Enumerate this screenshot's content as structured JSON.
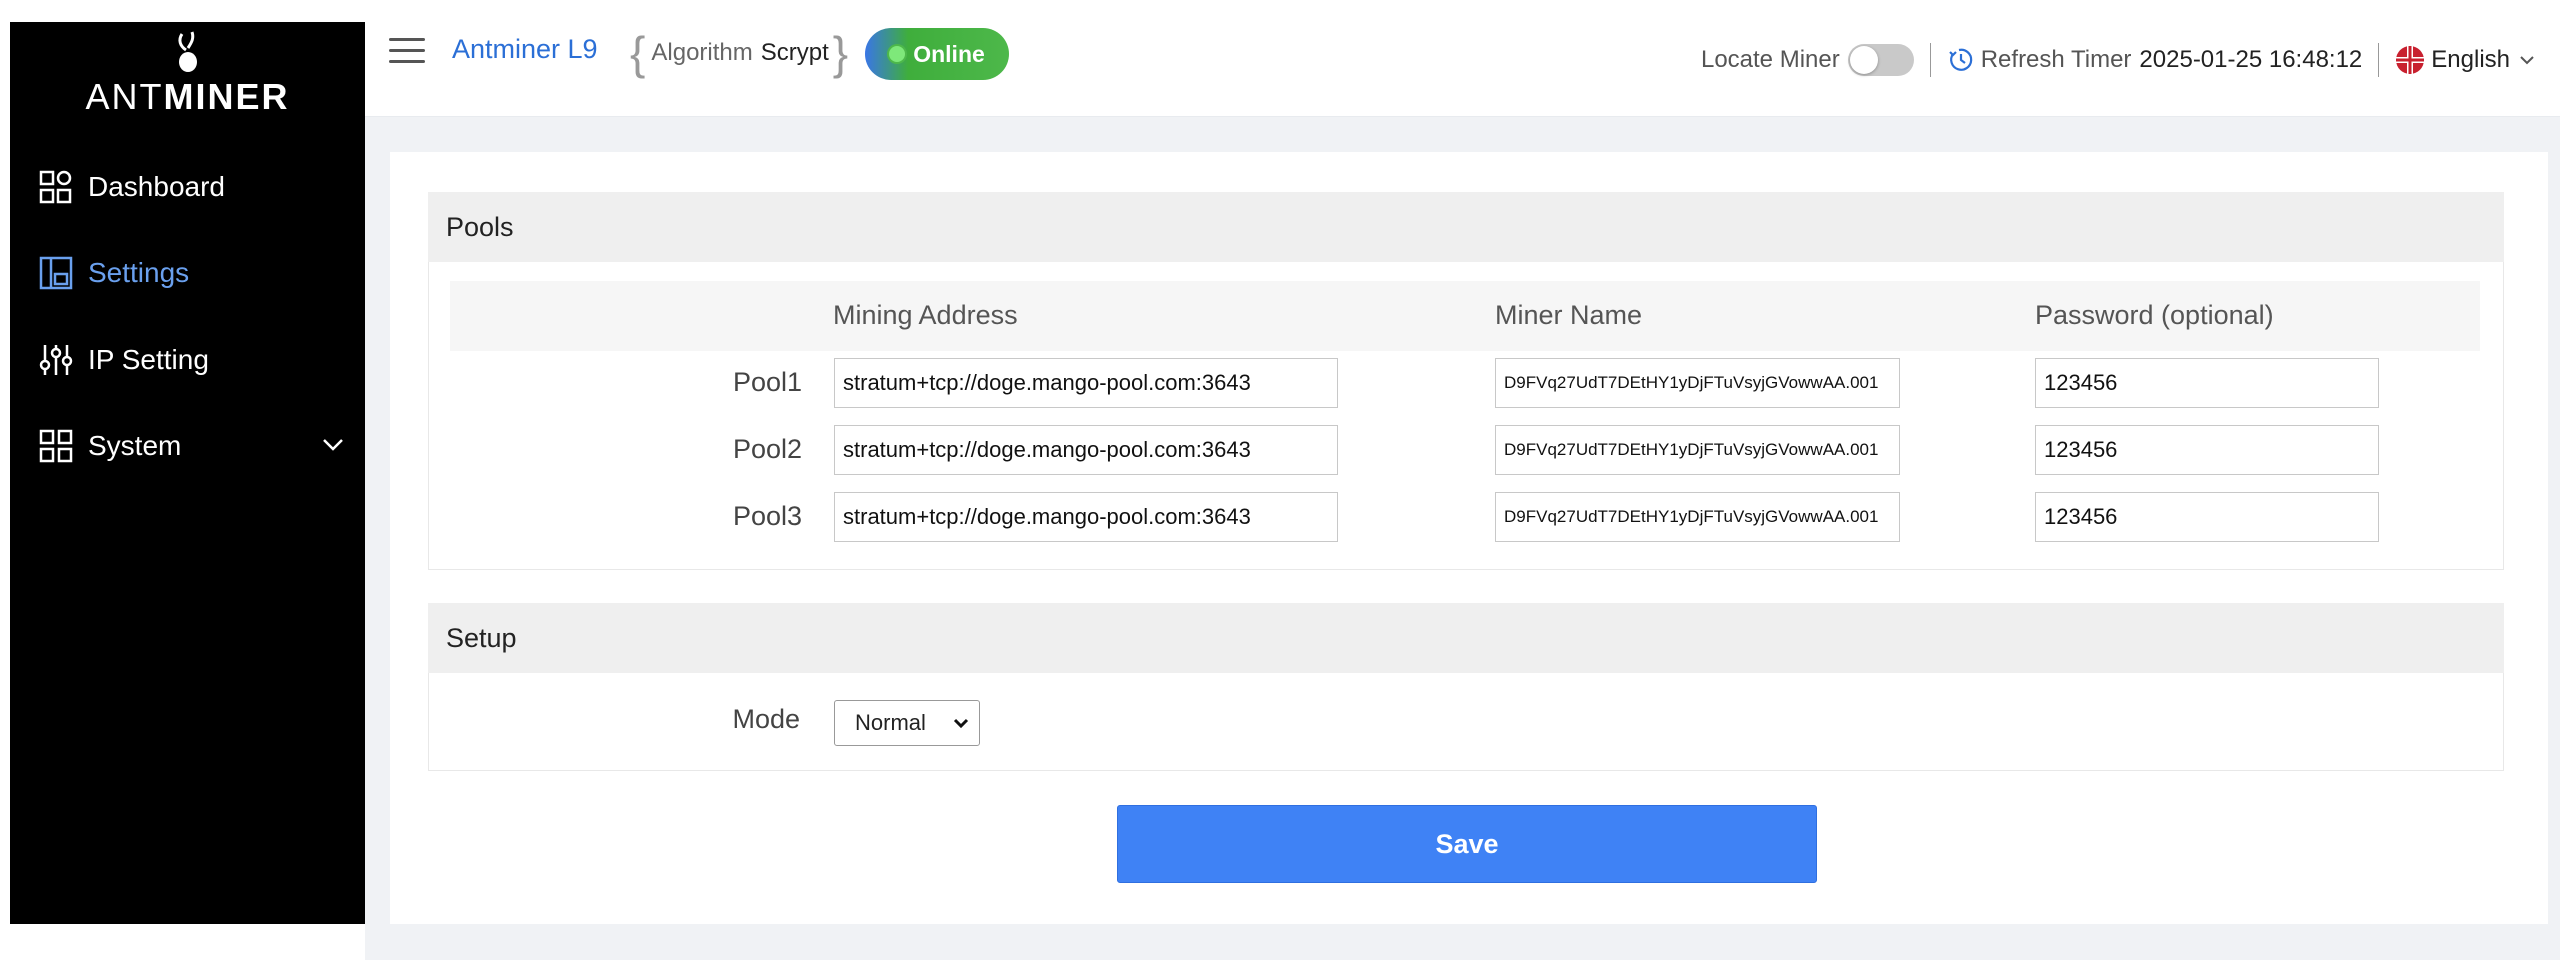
{
  "sidebar": {
    "brand_light": "ANT",
    "brand_bold": "MINER",
    "items": [
      {
        "label": "Dashboard",
        "icon": "dashboard-icon",
        "active": false
      },
      {
        "label": "Settings",
        "icon": "settings-icon",
        "active": true
      },
      {
        "label": "IP Setting",
        "icon": "sliders-icon",
        "active": false
      },
      {
        "label": "System",
        "icon": "system-icon",
        "active": false,
        "has_chevron": true
      }
    ]
  },
  "header": {
    "model": "Antminer L9",
    "algorithm_label": "Algorithm",
    "algorithm_value": "Scrypt",
    "status": "Online",
    "locate_miner_label": "Locate Miner",
    "locate_miner_on": false,
    "refresh_timer_label": "Refresh Timer",
    "refresh_timer_value": "2025-01-25 16:48:12",
    "language": "English"
  },
  "pools": {
    "section_title": "Pools",
    "columns": [
      "Mining Address",
      "Miner Name",
      "Password (optional)"
    ],
    "rows": [
      {
        "label": "Pool1",
        "address": "stratum+tcp://doge.mango-pool.com:3643",
        "miner_name": "D9FVq27UdT7DEtHY1yDjFTuVsyjGVowwAA.001",
        "password": "123456"
      },
      {
        "label": "Pool2",
        "address": "stratum+tcp://doge.mango-pool.com:3643",
        "miner_name": "D9FVq27UdT7DEtHY1yDjFTuVsyjGVowwAA.001",
        "password": "123456"
      },
      {
        "label": "Pool3",
        "address": "stratum+tcp://doge.mango-pool.com:3643",
        "miner_name": "D9FVq27UdT7DEtHY1yDjFTuVsyjGVowwAA.001",
        "password": "123456"
      }
    ]
  },
  "setup": {
    "section_title": "Setup",
    "mode_label": "Mode",
    "mode_value": "Normal"
  },
  "save_label": "Save",
  "colors": {
    "accent": "#3f82f5",
    "active_nav": "#6aa0ee",
    "online": "#4db84a",
    "sidebar_bg": "#000000"
  }
}
